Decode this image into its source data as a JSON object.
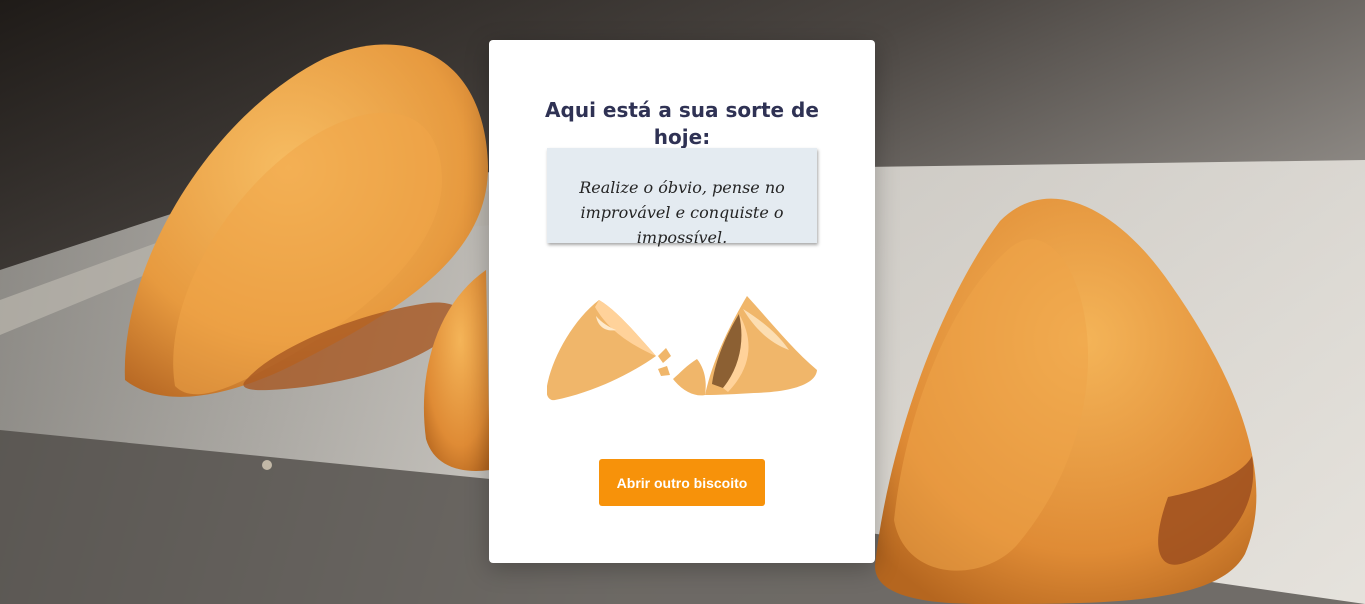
{
  "card": {
    "title": "Aqui está a sua sorte de hoje:",
    "fortune": "Realize o óbvio, pense no improvável e conquiste o impossível.",
    "button_label": "Abrir outro biscoito"
  },
  "colors": {
    "title": "#2f3254",
    "fortune_background": "#e4ebf1",
    "button": "#f7920a",
    "cookie": "#f0b66a"
  },
  "icons": {
    "illustration": "broken-fortune-cookie-icon"
  }
}
